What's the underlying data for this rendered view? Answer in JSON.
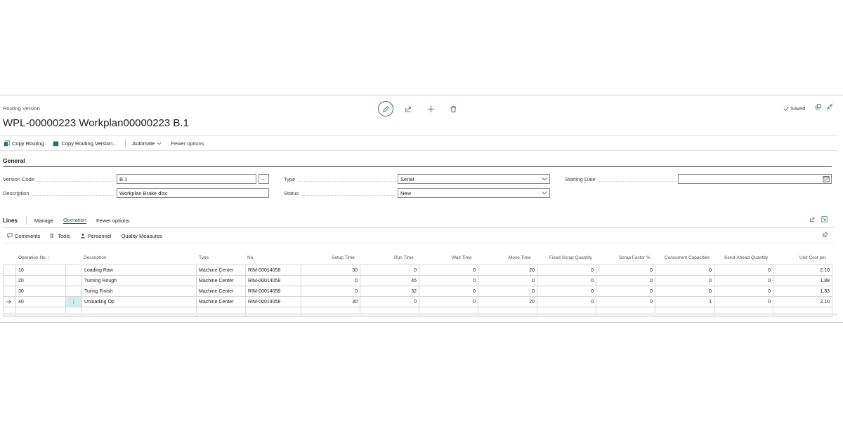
{
  "header": {
    "caption": "Routing Version",
    "title": "WPL-00000223 Workplan00000223 B.1",
    "saved_label": "Saved",
    "icons": [
      "edit-icon",
      "share-icon",
      "add-icon",
      "delete-icon",
      "open-new-window-icon",
      "collapse-icon"
    ]
  },
  "actions": {
    "copy_routing": "Copy Routing",
    "copy_routing_version": "Copy Routing Version...",
    "automate": "Automate",
    "fewer_options": "Fewer options"
  },
  "general": {
    "title": "General",
    "version_code_label": "Version Code",
    "version_code_value": "B.1",
    "description_label": "Description",
    "description_value": "Workplan Brake disc",
    "type_label": "Type",
    "type_value": "Serial",
    "status_label": "Status",
    "status_value": "New",
    "starting_date_label": "Starting Date",
    "starting_date_value": ""
  },
  "lines": {
    "title": "Lines",
    "tab_manage": "Manage",
    "tab_operation": "Operation",
    "tab_fewer_options": "Fewer options",
    "sub_comments": "Comments",
    "sub_tools": "Tools",
    "sub_personnel": "Personnel",
    "sub_quality_measures": "Quality Measures",
    "columns": {
      "operation_no": "Operation No. ↑",
      "description": "Description",
      "type": "Type",
      "no": "No.",
      "setup_time": "Setup Time",
      "run_time": "Run Time",
      "wait_time": "Wait Time",
      "move_time": "Move Time",
      "fixed_scrap_quantity": "Fixed Scrap Quantity",
      "scrap_factor": "Scrap Factor %",
      "concurrent_capacities": "Concurrent Capacities",
      "send_ahead_quantity": "Send-Ahead Quantity",
      "unit_cost_per": "Unit Cost per"
    },
    "rows": [
      {
        "op": "10",
        "desc": "Loading Raw",
        "type": "Machine Center",
        "no": "RIM-00014058",
        "setup": "30",
        "run": "0",
        "wait": "0",
        "move": "20",
        "fixed": "0",
        "scrap": "0",
        "conc": "0",
        "send": "0",
        "cost": "2.10"
      },
      {
        "op": "20",
        "desc": "Turning Rough",
        "type": "Machine Center",
        "no": "RIM-00014058",
        "setup": "0",
        "run": "45",
        "wait": "0",
        "move": "0",
        "fixed": "0",
        "scrap": "0",
        "conc": "0",
        "send": "0",
        "cost": "1.88"
      },
      {
        "op": "30",
        "desc": "Turing Finish",
        "type": "Machine Center",
        "no": "RIM-00014058",
        "setup": "0",
        "run": "32",
        "wait": "0",
        "move": "0",
        "fixed": "0",
        "scrap": "0",
        "conc": "0",
        "send": "0",
        "cost": "1.33"
      },
      {
        "op": "40",
        "desc": "Unloading Op",
        "type": "Machine Center",
        "no": "RIM-00014058",
        "setup": "30",
        "run": "0",
        "wait": "0",
        "move": "20",
        "fixed": "0",
        "scrap": "0",
        "conc": "1",
        "send": "0",
        "cost": "2.10"
      }
    ]
  },
  "colors": {
    "accent": "#0d6a6a",
    "selected_cell": "#cfeeee",
    "border": "#d6d6d6"
  }
}
